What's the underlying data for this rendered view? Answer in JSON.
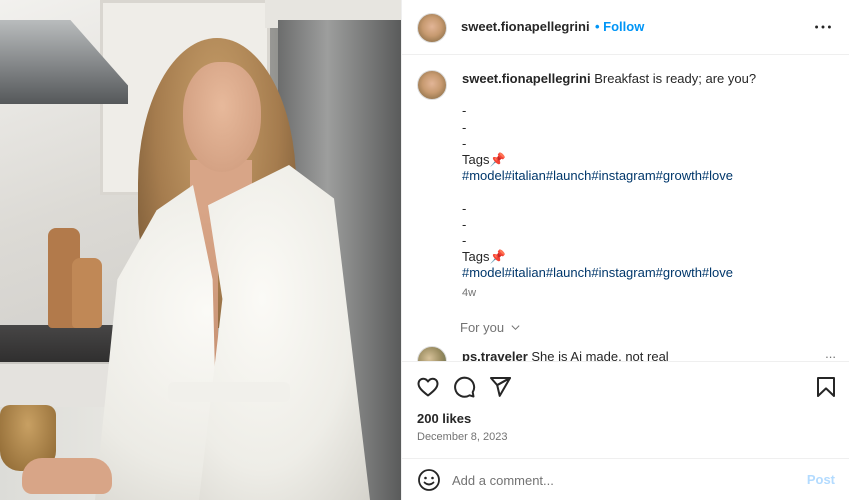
{
  "post": {
    "username": "sweet.fionapellegrini",
    "follow_label": "Follow",
    "caption_username": "sweet.fionapellegrini",
    "caption_text": "Breakfast is ready; are you?",
    "dash1": "-",
    "dash2": "-",
    "dash3": "-",
    "tags_label_1": "Tags",
    "hashtags_1": "#model#italian#launch#instagram#growth#love",
    "dash4": "-",
    "dash5": "-",
    "dash6": "-",
    "tags_label_2": "Tags",
    "hashtags_2": "#model#italian#launch#instagram#growth#love",
    "pin_emoji": "📌",
    "time_ago": "4w",
    "for_you_label": "For you",
    "likes": "200 likes",
    "date": "December 8, 2023"
  },
  "comment": {
    "username": "ps.traveler",
    "text": "She is Ai made, not real",
    "more": "..."
  },
  "composer": {
    "placeholder": "Add a comment...",
    "post_label": "Post"
  },
  "icons": {
    "more": "more-horizontal-icon",
    "like": "heart-icon",
    "comment": "comment-icon",
    "share": "send-icon",
    "save": "bookmark-icon",
    "emoji": "emoji-icon"
  },
  "colors": {
    "accent": "#0095f6",
    "link": "#00376b",
    "muted": "#737373",
    "post_disabled": "#b3dbff"
  }
}
